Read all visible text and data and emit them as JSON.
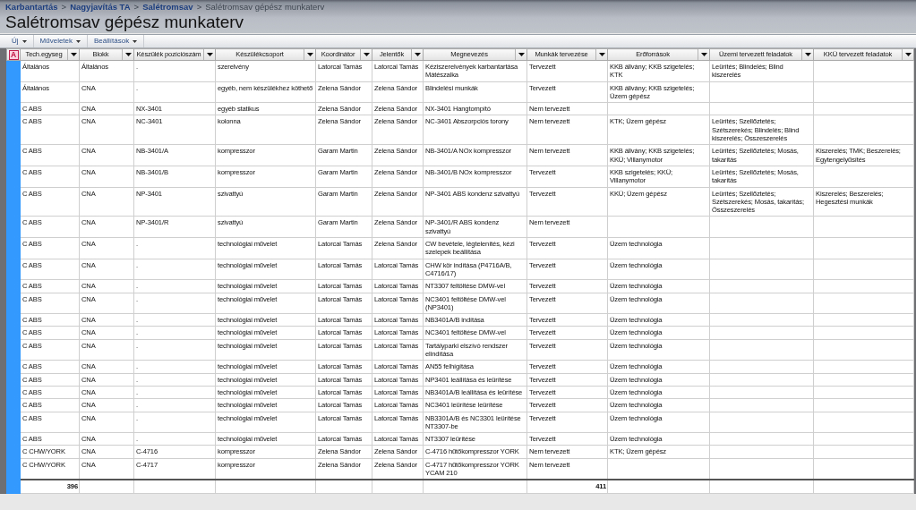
{
  "breadcrumb": {
    "separator": ">",
    "items": [
      {
        "label": "Karbantartás",
        "current": false
      },
      {
        "label": "Nagyjavítás TA",
        "current": false
      },
      {
        "label": "Salétromsav",
        "current": false
      },
      {
        "label": "Salétromsav gépész munkaterv",
        "current": true
      }
    ]
  },
  "title": "Salétromsav gépész munkaterv",
  "toolbar": [
    {
      "label": "Új"
    },
    {
      "label": "Műveletek"
    },
    {
      "label": "Beállítások"
    }
  ],
  "grid": {
    "corner_label": "A",
    "columns": [
      {
        "label": "Tech.egyseg"
      },
      {
        "label": "Blokk"
      },
      {
        "label": "Készülék pozíciószám"
      },
      {
        "label": "Készülékcsoport"
      },
      {
        "label": "Koordinátor"
      },
      {
        "label": "Jelentők"
      },
      {
        "label": "Megnevezés"
      },
      {
        "label": "Munkák tervezése"
      },
      {
        "label": "Erőforrások"
      },
      {
        "label": "Üzemi tervezett feladatok"
      },
      {
        "label": "KKÜ tervezett feladatok"
      }
    ],
    "rows": [
      {
        "tech": "Általános",
        "blokk": "Általános",
        "pozicio": ".",
        "csoport": "szerelvény",
        "koordinator": "Latorcai Tamás",
        "jelentok": "Latorcai Tamás",
        "megnevezes": "Kéziszerelvények karbantartása Mátészalka",
        "munkak": "Tervezett",
        "eroforrasok": "KKB állvány; KKB szigetelés; KTK",
        "uzemi": "Leürítés; Blindelés; Blind kiszerelés"
      },
      {
        "tech": "Általános",
        "blokk": "CNA",
        "pozicio": ".",
        "csoport": "egyéb, nem készülékhez köthető",
        "koordinator": "Zelena Sándor",
        "jelentok": "Zelena Sándor",
        "megnevezes": "Blindelési munkák",
        "munkak": "Tervezett",
        "eroforrasok": "KKB állvány; KKB szigetelés; Üzem gépész"
      },
      {
        "tech": "C ABS",
        "blokk": "CNA",
        "pozicio": "NX-3401",
        "csoport": "egyéb statikus",
        "koordinator": "Zelena Sándor",
        "jelentok": "Zelena Sándor",
        "megnevezes": "NX-3401 Hangtompító",
        "munkak": "Nem tervezett"
      },
      {
        "tech": "C ABS",
        "blokk": "CNA",
        "pozicio": "NC-3401",
        "csoport": "kolonna",
        "koordinator": "Zelena Sándor",
        "jelentok": "Zelena Sándor",
        "megnevezes": "NC-3401 Abszorpciós torony",
        "munkak": "Nem tervezett",
        "eroforrasok": "KTK; Üzem gépész",
        "uzemi": "Leürítés; Szellőztetés; Szétszerekés; Blindelés; Blind kiszerelés; Összeszerelés"
      },
      {
        "tech": "C ABS",
        "blokk": "CNA",
        "pozicio": "NB-3401/A",
        "csoport": "kompresszor",
        "koordinator": "Garam Martin",
        "jelentok": "Zelena Sándor",
        "megnevezes": "NB-3401/A NOx kompresszor",
        "munkak": "Nem tervezett",
        "eroforrasok": "KKB állvány; KKB szigetelés; KKÜ; Villanymotor",
        "uzemi": "Leürítés; Szellőztetés; Mosás, takarítás",
        "kku": "Kiszerelés; TMK; Beszerelés; Egytengelyűsítés"
      },
      {
        "tech": "C ABS",
        "blokk": "CNA",
        "pozicio": "NB-3401/B",
        "csoport": "kompresszor",
        "koordinator": "Garam Martin",
        "jelentok": "Zelena Sándor",
        "megnevezes": "NB-3401/B NOx kompresszor",
        "munkak": "Tervezett",
        "eroforrasok": "KKB szigetelés; KKÜ; Villanymotor",
        "uzemi": "Leürítés; Szellőztetés; Mosás, takarítás"
      },
      {
        "tech": "C ABS",
        "blokk": "CNA",
        "pozicio": "NP-3401",
        "csoport": "szivattyú",
        "koordinator": "Garam Martin",
        "jelentok": "Zelena Sándor",
        "megnevezes": "NP-3401 ABS kondenz szivattyú",
        "munkak": "Tervezett",
        "eroforrasok": "KKÜ; Üzem gépész",
        "uzemi": "Leürítés; Szellőztetés; Szétszerekés; Mosás, takarítás; Összeszerelés",
        "kku": "Kiszerelés; Beszerelés; Hegesztési munkák"
      },
      {
        "tech": "C ABS",
        "blokk": "CNA",
        "pozicio": "NP-3401/R",
        "csoport": "szivattyú",
        "koordinator": "Garam Martin",
        "jelentok": "Zelena Sándor",
        "megnevezes": "NP-3401/R ABS kondenz szivattyú",
        "munkak": "Nem tervezett"
      },
      {
        "tech": "C ABS",
        "blokk": "CNA",
        "pozicio": ".",
        "csoport": "technológiai művelet",
        "koordinator": "Latorcai Tamás",
        "jelentok": "Zelena Sándor",
        "megnevezes": "CW bevétele, légtelenítés, kézi szelepek beállítása",
        "munkak": "Tervezett",
        "eroforrasok": "Üzem technológia"
      },
      {
        "tech": "C ABS",
        "blokk": "CNA",
        "pozicio": ".",
        "csoport": "technológiai művelet",
        "koordinator": "Latorcai Tamás",
        "jelentok": "Latorcai Tamás",
        "megnevezes": "CHW kör indítása (P4716A/B, C4716/17)",
        "munkak": "Tervezett",
        "eroforrasok": "Üzem technológia"
      },
      {
        "tech": "C ABS",
        "blokk": "CNA",
        "pozicio": ".",
        "csoport": "technológiai művelet",
        "koordinator": "Latorcai Tamás",
        "jelentok": "Latorcai Tamás",
        "megnevezes": "NT3307 feltöltése DMW-vel",
        "munkak": "Tervezett",
        "eroforrasok": "Üzem technológia"
      },
      {
        "tech": "C ABS",
        "blokk": "CNA",
        "pozicio": ".",
        "csoport": "technológiai művelet",
        "koordinator": "Latorcai Tamás",
        "jelentok": "Latorcai Tamás",
        "megnevezes": "NC3401 feltöltése DMW-vel (NP3401)",
        "munkak": "Tervezett",
        "eroforrasok": "Üzem technológia"
      },
      {
        "tech": "C ABS",
        "blokk": "CNA",
        "pozicio": ".",
        "csoport": "technológiai művelet",
        "koordinator": "Latorcai Tamás",
        "jelentok": "Latorcai Tamás",
        "megnevezes": "NB3401A/B indítása",
        "munkak": "Tervezett",
        "eroforrasok": "Üzem technológia"
      },
      {
        "tech": "C ABS",
        "blokk": "CNA",
        "pozicio": ".",
        "csoport": "technológiai művelet",
        "koordinator": "Latorcai Tamás",
        "jelentok": "Latorcai Tamás",
        "megnevezes": "NC3401 feltöltése DMW-vel",
        "munkak": "Tervezett",
        "eroforrasok": "Üzem technológia"
      },
      {
        "tech": "C ABS",
        "blokk": "CNA",
        "pozicio": ".",
        "csoport": "technológiai művelet",
        "koordinator": "Latorcai Tamás",
        "jelentok": "Latorcai Tamás",
        "megnevezes": "Tartályparki elszívó rendszer elindítása",
        "munkak": "Tervezett",
        "eroforrasok": "Üzem technológia"
      },
      {
        "tech": "C ABS",
        "blokk": "CNA",
        "pozicio": ".",
        "csoport": "technológiai művelet",
        "koordinator": "Latorcai Tamás",
        "jelentok": "Latorcai Tamás",
        "megnevezes": "AN55 felhígítása",
        "munkak": "Tervezett",
        "eroforrasok": "Üzem technológia"
      },
      {
        "tech": "C ABS",
        "blokk": "CNA",
        "pozicio": ".",
        "csoport": "technológiai művelet",
        "koordinator": "Latorcai Tamás",
        "jelentok": "Latorcai Tamás",
        "megnevezes": "NP3401 leállítása és leürítése",
        "munkak": "Tervezett",
        "eroforrasok": "Üzem technológia"
      },
      {
        "tech": "C ABS",
        "blokk": "CNA",
        "pozicio": ".",
        "csoport": "technológiai művelet",
        "koordinator": "Latorcai Tamás",
        "jelentok": "Latorcai Tamás",
        "megnevezes": "NB3401A/B leállítása és leürítése",
        "munkak": "Tervezett",
        "eroforrasok": "Üzem technológia"
      },
      {
        "tech": "C ABS",
        "blokk": "CNA",
        "pozicio": ".",
        "csoport": "technológiai művelet",
        "koordinator": "Latorcai Tamás",
        "jelentok": "Latorcai Tamás",
        "megnevezes": "NC3401 leürítése leürítése",
        "munkak": "Tervezett",
        "eroforrasok": "Üzem technológia"
      },
      {
        "tech": "C ABS",
        "blokk": "CNA",
        "pozicio": ".",
        "csoport": "technológiai művelet",
        "koordinator": "Latorcai Tamás",
        "jelentok": "Latorcai Tamás",
        "megnevezes": "NB3301A/B és NC3301 leürítése NT3307-be",
        "munkak": "Tervezett",
        "eroforrasok": "Üzem technológia"
      },
      {
        "tech": "C ABS",
        "blokk": "CNA",
        "pozicio": ".",
        "csoport": "technológiai művelet",
        "koordinator": "Latorcai Tamás",
        "jelentok": "Latorcai Tamás",
        "megnevezes": "NT3307 leürítése",
        "munkak": "Tervezett",
        "eroforrasok": "Üzem technológia"
      },
      {
        "tech": "C CHW/YORK",
        "blokk": "CNA",
        "pozicio": "C-4716",
        "csoport": "kompresszor",
        "koordinator": "Zelena Sándor",
        "jelentok": "Zelena Sándor",
        "megnevezes": "C-4716 hűtőkompresszor YORK",
        "munkak": "Nem tervezett",
        "eroforrasok": "KTK; Üzem gépész"
      },
      {
        "tech": "C CHW/YORK",
        "blokk": "CNA",
        "pozicio": "C-4717",
        "csoport": "kompresszor",
        "koordinator": "Zelena Sándor",
        "jelentok": "Zelena Sándor",
        "megnevezes": "C-4717 hűtőkompresszor YORK YCAM 210",
        "munkak": "Nem tervezett"
      }
    ],
    "totals": {
      "tech": "396",
      "munkak": "411"
    }
  }
}
